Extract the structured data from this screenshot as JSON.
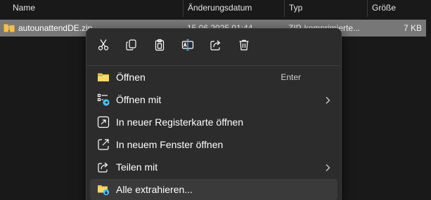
{
  "columns": {
    "name": "Name",
    "date": "Änderungsdatum",
    "type": "Typ",
    "size": "Größe"
  },
  "file": {
    "name": "autounattendDE.zip",
    "date": "15.06.2025 01:44",
    "type": "ZIP-komprimierte...",
    "size": "7 KB",
    "icon": "zip-folder-icon"
  },
  "quick_actions": [
    {
      "name": "cut",
      "icon": "scissors-icon"
    },
    {
      "name": "copy",
      "icon": "copy-icon"
    },
    {
      "name": "paste",
      "icon": "clipboard-icon"
    },
    {
      "name": "rename",
      "icon": "rename-icon"
    },
    {
      "name": "share",
      "icon": "share-icon"
    },
    {
      "name": "delete",
      "icon": "trash-icon"
    }
  ],
  "menu": {
    "items": [
      {
        "label": "Öffnen",
        "shortcut": "Enter",
        "icon": "folder-icon",
        "submenu": false
      },
      {
        "label": "Öffnen mit",
        "icon": "open-with-icon",
        "submenu": true
      },
      {
        "label": "In neuer Registerkarte öffnen",
        "icon": "new-tab-icon",
        "submenu": false
      },
      {
        "label": "In neuem Fenster öffnen",
        "icon": "new-window-icon",
        "submenu": false
      },
      {
        "label": "Teilen mit",
        "icon": "share-with-icon",
        "submenu": true
      },
      {
        "label": "Alle extrahieren...",
        "icon": "extract-folder-icon",
        "submenu": false
      }
    ]
  },
  "colors": {
    "accent": "#4cc2ff",
    "folder_yellow": "#f2c14e",
    "selection": "#777777",
    "menu_bg": "#2c2c2c"
  }
}
